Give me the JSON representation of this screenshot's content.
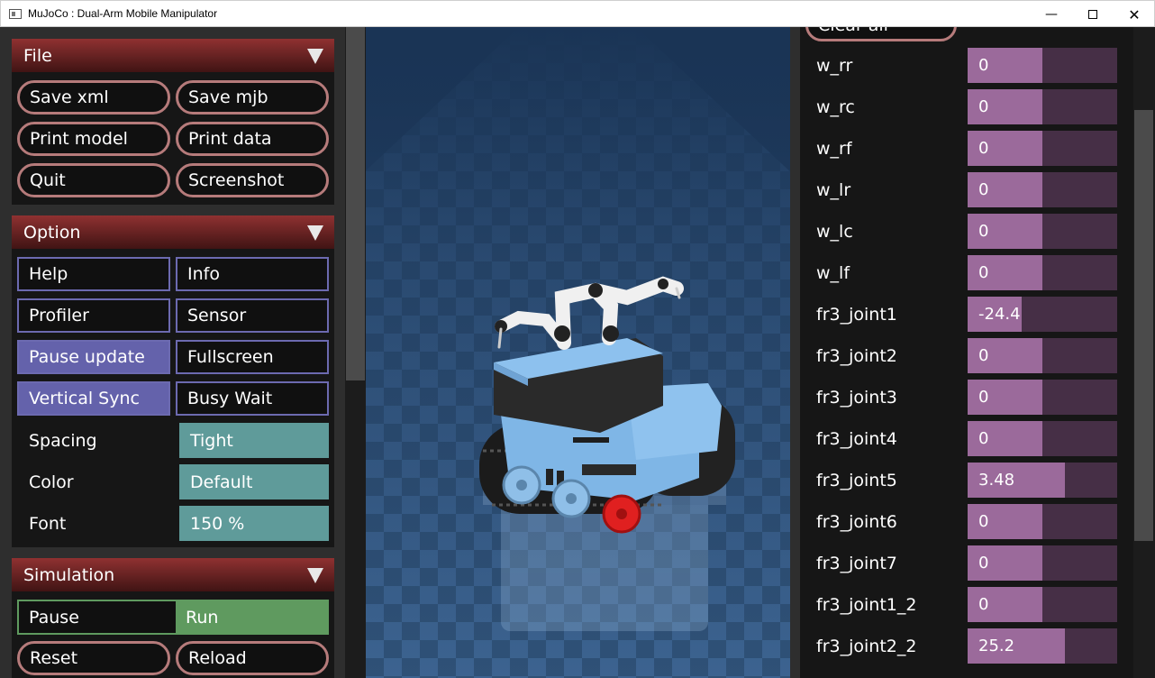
{
  "window": {
    "title": "MuJoCo : Dual-Arm Mobile Manipulator"
  },
  "file": {
    "header": "File",
    "save_xml": "Save xml",
    "save_mjb": "Save mjb",
    "print_model": "Print model",
    "print_data": "Print data",
    "quit": "Quit",
    "screenshot": "Screenshot"
  },
  "option": {
    "header": "Option",
    "help": "Help",
    "info": "Info",
    "profiler": "Profiler",
    "sensor": "Sensor",
    "pause_update": "Pause update",
    "fullscreen": "Fullscreen",
    "vertical_sync": "Vertical Sync",
    "busy_wait": "Busy Wait",
    "spacing_label": "Spacing",
    "spacing_value": "Tight",
    "color_label": "Color",
    "color_value": "Default",
    "font_label": "Font",
    "font_value": "150 %"
  },
  "simulation": {
    "header": "Simulation",
    "pause": "Pause",
    "run": "Run",
    "reset": "Reset",
    "reload": "Reload"
  },
  "control": {
    "clear_all": "Clear all",
    "rows": [
      {
        "label": "w_rr",
        "value": "0",
        "fraction": 0.5
      },
      {
        "label": "w_rc",
        "value": "0",
        "fraction": 0.5
      },
      {
        "label": "w_rf",
        "value": "0",
        "fraction": 0.5
      },
      {
        "label": "w_lr",
        "value": "0",
        "fraction": 0.5
      },
      {
        "label": "w_lc",
        "value": "0",
        "fraction": 0.5
      },
      {
        "label": "w_lf",
        "value": "0",
        "fraction": 0.5
      },
      {
        "label": "fr3_joint1",
        "value": "-24.4",
        "fraction": 0.36
      },
      {
        "label": "fr3_joint2",
        "value": "0",
        "fraction": 0.5
      },
      {
        "label": "fr3_joint3",
        "value": "0",
        "fraction": 0.5
      },
      {
        "label": "fr3_joint4",
        "value": "0",
        "fraction": 0.5
      },
      {
        "label": "fr3_joint5",
        "value": "3.48",
        "fraction": 0.65
      },
      {
        "label": "fr3_joint6",
        "value": "0",
        "fraction": 0.5
      },
      {
        "label": "fr3_joint7",
        "value": "0",
        "fraction": 0.5
      },
      {
        "label": "fr3_joint1_2",
        "value": "0",
        "fraction": 0.5
      },
      {
        "label": "fr3_joint2_2",
        "value": "25.2",
        "fraction": 0.65
      }
    ]
  },
  "colors": {
    "header_red": "#8f3131",
    "button_border": "#b67b7b",
    "checkbox_on": "#6462ab",
    "select_teal": "#5f9b9a",
    "run_green": "#5f9a5f",
    "slider_fill": "#9b6a9b",
    "slider_track": "#462f46"
  }
}
